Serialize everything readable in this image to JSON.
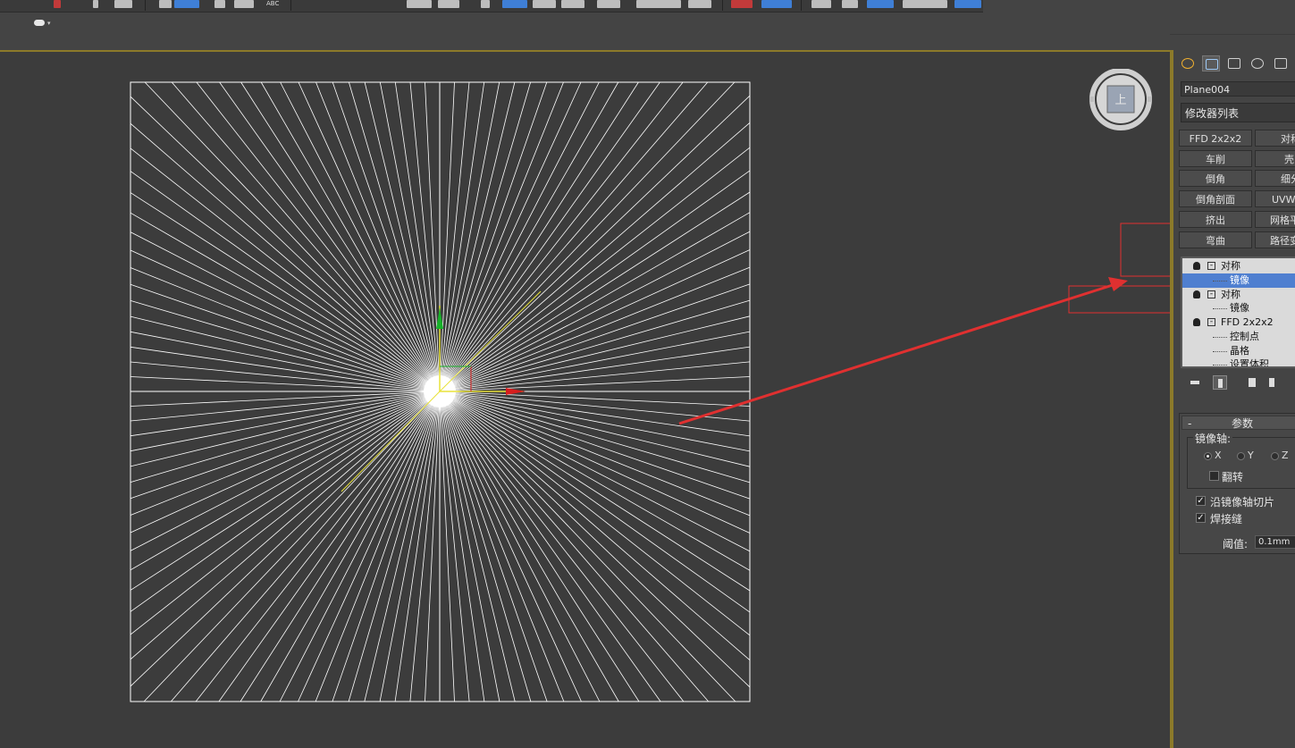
{
  "toolbar": {
    "abc_label": "ABC"
  },
  "viewport": {
    "viewcube_face": "上"
  },
  "panel": {
    "tabs": [
      "create-icon",
      "modify-icon",
      "hierarchy-icon",
      "motion-icon",
      "display-icon"
    ],
    "object_name": "Plane004",
    "modifier_list": "修改器列表",
    "modifier_buttons": [
      "FFD 2x2x2",
      "对称",
      "车削",
      "壳",
      "倒角",
      "细分",
      "倒角剖面",
      "UVW 贴图",
      "挤出",
      "网格平滑",
      "弯曲",
      "路径变形"
    ],
    "stack": {
      "item1": "对称",
      "item1_sub": "镜像",
      "item2": "对称",
      "item2_sub": "镜像",
      "item3": "FFD 2x2x2",
      "item3_sub1": "控制点",
      "item3_sub2": "晶格",
      "item3_sub3": "设置体积"
    },
    "params": {
      "collapse": "-",
      "title": "参数",
      "mirror_axis_label": "镜像轴:",
      "axis_x": "X",
      "axis_y": "Y",
      "axis_z": "Z",
      "flip_label": "翻转",
      "slice_label": "沿镜像轴切片",
      "weld_label": "焊接缝",
      "threshold_label": "阈值:",
      "threshold_value": "0.1mm"
    }
  },
  "colors": {
    "accent_selection": "#4f7fd0",
    "annotation_red": "#e03030",
    "viewport_border": "#8c7a2a"
  }
}
